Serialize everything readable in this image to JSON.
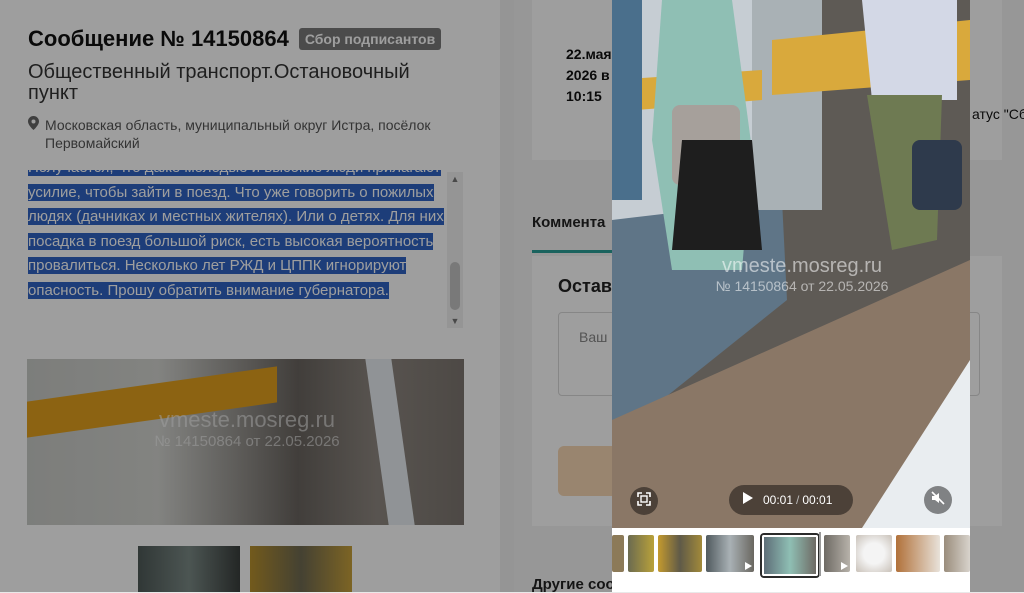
{
  "header": {
    "title": "Сообщение № 14150864",
    "status_badge": "Сбор подписантов"
  },
  "details": {
    "category": "Общественный транспорт.Остановочный пункт",
    "address": "Московская область, муниципальный округ Истра, посёлок Первомайский",
    "selected_text": "Получается, что даже молодые и высокие люди прилагают усилие, чтобы зайти в поезд. Что уже говорить о пожилых людях (дачниках и местных жителях). Или о детях. Для них посадка в поезд большой риск, есть высокая вероятность провалиться. Несколько лет РЖД и ЦППК игнорируют опасность. Прошу обратить внимание губернатора."
  },
  "watermark": {
    "site": "vmeste.mosreg.ru",
    "main_photo_caption": "№ 14150864 от 22.05.2026",
    "video_caption": "№ 14150864 от 22.05.2026"
  },
  "info": {
    "date": "22.мая 2026 в 10:15",
    "status_note": "атус \"Сб"
  },
  "comments": {
    "tab_label": "Коммента",
    "leave_title": "Оставь",
    "placeholder": "Ваш"
  },
  "other": {
    "title": "Другие соо"
  },
  "player": {
    "current_time": "00:01",
    "separator": "/",
    "duration": "00:01"
  },
  "icons": {
    "pin": "map-pin-icon",
    "fullscreen": "fullscreen-icon",
    "play": "play-icon",
    "mute": "muted-speaker-icon"
  },
  "colors": {
    "selection": "#2f63c4",
    "accent_teal": "#2aa198",
    "button_peach": "#f7d7b3",
    "stripe_yellow": "#e3a11e"
  }
}
